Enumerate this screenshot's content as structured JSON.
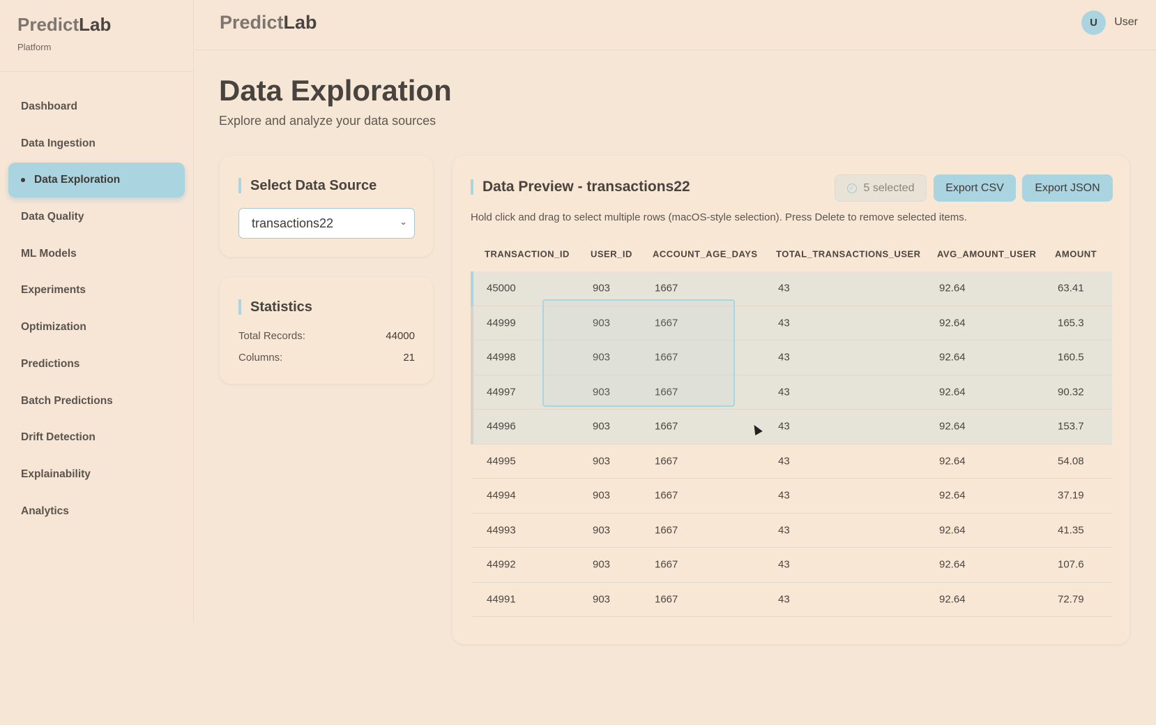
{
  "sidebar": {
    "brand_prefix": "Predict",
    "brand_suffix": "Lab",
    "subtitle": "Platform",
    "items": [
      {
        "label": "Dashboard"
      },
      {
        "label": "Data Ingestion"
      },
      {
        "label": "Data Exploration",
        "active": true
      },
      {
        "label": "Data Quality"
      },
      {
        "label": "ML Models"
      },
      {
        "label": "Experiments"
      },
      {
        "label": "Optimization"
      },
      {
        "label": "Predictions"
      },
      {
        "label": "Batch Predictions"
      },
      {
        "label": "Drift Detection"
      },
      {
        "label": "Explainability"
      },
      {
        "label": "Analytics"
      }
    ]
  },
  "header": {
    "brand_prefix": "Predict",
    "brand_suffix": "Lab",
    "avatar_initial": "U",
    "user": "User"
  },
  "page": {
    "title": "Data Exploration",
    "subtitle": "Explore and analyze your data sources"
  },
  "source": {
    "title": "Select Data Source",
    "selected": "transactions22"
  },
  "stats": {
    "title": "Statistics",
    "total_label": "Total Records:",
    "total": "44000",
    "columns_label": "Columns:",
    "columns": "21"
  },
  "preview": {
    "title": "Data Preview - transactions22",
    "selected": "5 selected",
    "export_csv": "Export CSV",
    "export_json": "Export JSON",
    "hint": "Hold click and drag to select multiple rows (macOS-style selection). Press Delete to remove selected items.",
    "columns": [
      "TRANSACTION_ID",
      "USER_ID",
      "ACCOUNT_AGE_DAYS",
      "TOTAL_TRANSACTIONS_USER",
      "AVG_AMOUNT_USER",
      "AMOUNT"
    ],
    "rows": [
      [
        "45000",
        "903",
        "1667",
        "43",
        "92.64",
        "63.41"
      ],
      [
        "44999",
        "903",
        "1667",
        "43",
        "92.64",
        "165.3"
      ],
      [
        "44998",
        "903",
        "1667",
        "43",
        "92.64",
        "160.5"
      ],
      [
        "44997",
        "903",
        "1667",
        "43",
        "92.64",
        "90.32"
      ],
      [
        "44996",
        "903",
        "1667",
        "43",
        "92.64",
        "153.7"
      ],
      [
        "44995",
        "903",
        "1667",
        "43",
        "92.64",
        "54.08"
      ],
      [
        "44994",
        "903",
        "1667",
        "43",
        "92.64",
        "37.19"
      ],
      [
        "44993",
        "903",
        "1667",
        "43",
        "92.64",
        "41.35"
      ],
      [
        "44992",
        "903",
        "1667",
        "43",
        "92.64",
        "107.6"
      ],
      [
        "44991",
        "903",
        "1667",
        "43",
        "92.64",
        "72.79"
      ]
    ]
  }
}
